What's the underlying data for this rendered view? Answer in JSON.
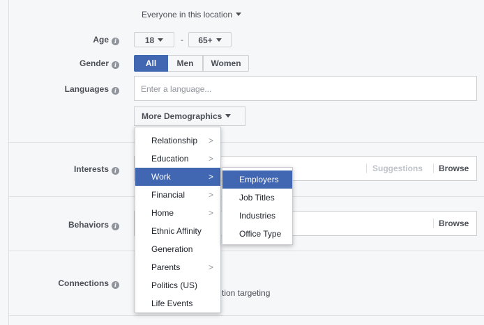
{
  "location": {
    "value": "Everyone in this location"
  },
  "age": {
    "label": "Age",
    "min": "18",
    "dash": "-",
    "max": "65+"
  },
  "gender": {
    "label": "Gender",
    "options": [
      "All",
      "Men",
      "Women"
    ],
    "selected": "All"
  },
  "languages": {
    "label": "Languages",
    "placeholder": "Enter a language..."
  },
  "more_demographics": {
    "label": "More Demographics"
  },
  "interests": {
    "label": "Interests",
    "suggestions": "Suggestions",
    "browse": "Browse"
  },
  "behaviors": {
    "label": "Behaviors",
    "browse": "Browse"
  },
  "connections": {
    "label": "Connections",
    "partial_text": "tion targeting"
  },
  "demographics_menu": {
    "items": [
      {
        "label": "Relationship",
        "submenu": true
      },
      {
        "label": "Education",
        "submenu": true
      },
      {
        "label": "Work",
        "submenu": true,
        "highlighted": true
      },
      {
        "label": "Financial",
        "submenu": true
      },
      {
        "label": "Home",
        "submenu": true
      },
      {
        "label": "Ethnic Affinity",
        "submenu": false
      },
      {
        "label": "Generation",
        "submenu": false
      },
      {
        "label": "Parents",
        "submenu": true
      },
      {
        "label": "Politics (US)",
        "submenu": false
      },
      {
        "label": "Life Events",
        "submenu": false
      }
    ]
  },
  "work_submenu": {
    "items": [
      {
        "label": "Employers",
        "highlighted": true
      },
      {
        "label": "Job Titles"
      },
      {
        "label": "Industries"
      },
      {
        "label": "Office Type"
      }
    ]
  },
  "icons": {
    "info": "i",
    "chevron": ">"
  },
  "colors": {
    "accent": "#4267b2",
    "link": "#4b4f56",
    "muted": "#bec2c9"
  }
}
